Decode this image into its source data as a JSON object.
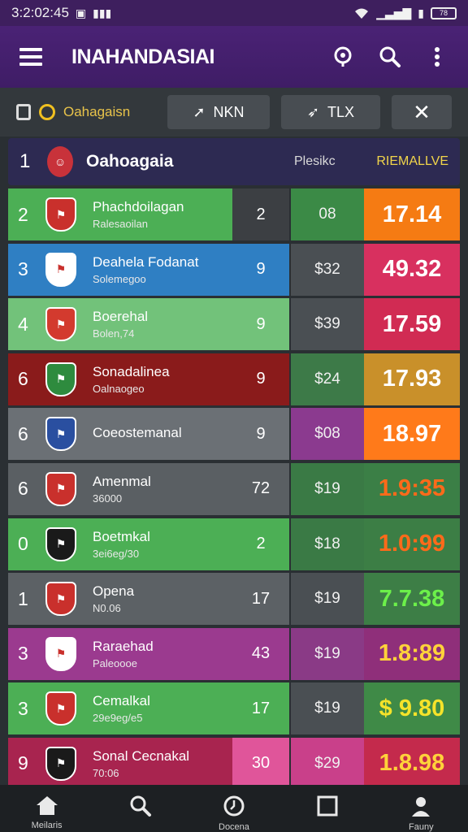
{
  "status_bar": {
    "time": "3:2:02:45",
    "battery": "78"
  },
  "app_bar": {
    "title": "INAHANDASIAI"
  },
  "filter_bar": {
    "league_label": "Oahagaisn",
    "btn1_label": "NKN",
    "btn2_label": "TLX",
    "close_label": "✕"
  },
  "header": {
    "rank": "1",
    "team": "Oahoagaia",
    "col1": "Plesikc",
    "col2": "RIEMALLVE"
  },
  "rows": [
    {
      "rank": "2",
      "name": "Phachdoilagan",
      "sub": "Ralesaoilan",
      "played": "2",
      "stat": "08",
      "value": "17.14",
      "team_bg": "#4caf55",
      "played_bg": "#3c3f43",
      "stat_bg": "#3b8a46",
      "val_bg": "#f57b13",
      "val_color": "#ffffff",
      "badge_bg": "#c9302c"
    },
    {
      "rank": "3",
      "name": "Deahela Fodanat",
      "sub": "Solemegoo",
      "played": "9",
      "stat": "$32",
      "value": "49.32",
      "team_bg": "#2f7fc3",
      "played_bg": "#2f7fc3",
      "stat_bg": "#4a4f53",
      "val_bg": "#d8305f",
      "val_color": "#ffffff",
      "badge_bg": "#ffffff"
    },
    {
      "rank": "4",
      "name": "Boerehal",
      "sub": "Bolen,74",
      "played": "9",
      "stat": "$39",
      "value": "17.59",
      "team_bg": "#72c27a",
      "played_bg": "#72c27a",
      "stat_bg": "#4a4f53",
      "val_bg": "#d12b53",
      "val_color": "#ffffff",
      "badge_bg": "#d33a2e"
    },
    {
      "rank": "6",
      "name": "Sonadalinea",
      "sub": "Oalnaogeo",
      "played": "9",
      "stat": "$24",
      "value": "17.93",
      "team_bg": "#8a1b1b",
      "played_bg": "#8a1b1b",
      "stat_bg": "#3d7a48",
      "val_bg": "#c9902a",
      "val_color": "#ffffff",
      "badge_bg": "#2e8b3e"
    },
    {
      "rank": "6",
      "name": "Coeostemanal",
      "sub": "",
      "played": "9",
      "stat": "$08",
      "value": "18.97",
      "team_bg": "#6b7075",
      "played_bg": "#6b7075",
      "stat_bg": "#8b3a8f",
      "val_bg": "#ff7a1a",
      "val_color": "#ffffff",
      "badge_bg": "#2a4fa0"
    },
    {
      "rank": "6",
      "name": "Amenmal",
      "sub": "36000",
      "played": "72",
      "stat": "$19",
      "value": "1.9:35",
      "team_bg": "#5a5f63",
      "played_bg": "#5a5f63",
      "stat_bg": "#3a7a45",
      "val_bg": "#3b7f46",
      "val_color": "#ff6a1a",
      "badge_bg": "#c9302c"
    },
    {
      "rank": "0",
      "name": "Boetmkal",
      "sub": "3ei6eg/30",
      "played": "2",
      "stat": "$18",
      "value": "1.0:99",
      "team_bg": "#4caf55",
      "played_bg": "#4caf55",
      "stat_bg": "#3a7a45",
      "val_bg": "#3c7e45",
      "val_color": "#ff6a1a",
      "badge_bg": "#1a1a1a"
    },
    {
      "rank": "1",
      "name": "Opena",
      "sub": "N0.06",
      "played": "17",
      "stat": "$19",
      "value": "7.7.38",
      "team_bg": "#5c6165",
      "played_bg": "#5c6165",
      "stat_bg": "#4a4f53",
      "val_bg": "#3d7e46",
      "val_color": "#6cf04a",
      "badge_bg": "#c9302c"
    },
    {
      "rank": "3",
      "name": "Raraehad",
      "sub": "Paleoooe",
      "played": "43",
      "stat": "$19",
      "value": "1.8:89",
      "team_bg": "#9b3a8f",
      "played_bg": "#9b3a8f",
      "stat_bg": "#8a3a86",
      "val_bg": "#8f2f7a",
      "val_color": "#ffd23a",
      "badge_bg": "#ffffff"
    },
    {
      "rank": "3",
      "name": "Cemalkal",
      "sub": "29e9eg/e5",
      "played": "17",
      "stat": "$19",
      "value": "$ 9.80",
      "team_bg": "#4caf55",
      "played_bg": "#4caf55",
      "stat_bg": "#4a4f53",
      "val_bg": "#3f8a47",
      "val_color": "#f5e32a",
      "badge_bg": "#c9302c"
    },
    {
      "rank": "9",
      "name": "Sonal Cecnakal",
      "sub": "70:06",
      "played": "30",
      "stat": "$29",
      "value": "1.8.98",
      "team_bg": "#a8244f",
      "played_bg": "#e0559a",
      "stat_bg": "#c9408a",
      "val_bg": "#c42a4c",
      "val_color": "#ffd23a",
      "badge_bg": "#1a1a1a"
    }
  ],
  "bottom_nav": [
    {
      "label": "Meilaris",
      "icon": "home-icon"
    },
    {
      "label": "",
      "icon": "search-icon"
    },
    {
      "label": "Docena",
      "icon": "clock-icon"
    },
    {
      "label": "",
      "icon": "square-icon"
    },
    {
      "label": "Fauny",
      "icon": "person-icon"
    }
  ]
}
